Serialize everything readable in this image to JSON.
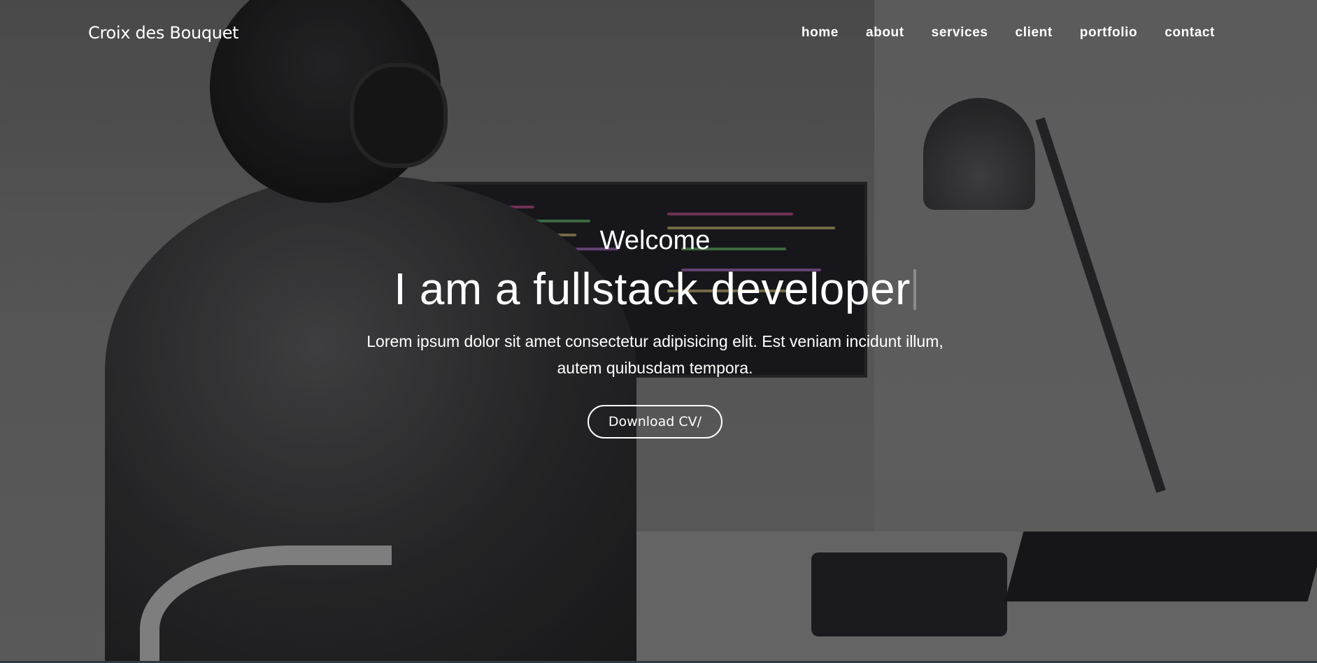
{
  "brand": {
    "name": "Croix des Bouquet"
  },
  "nav": {
    "items": [
      {
        "label": "home"
      },
      {
        "label": "about"
      },
      {
        "label": "services"
      },
      {
        "label": "client"
      },
      {
        "label": "portfolio"
      },
      {
        "label": "contact"
      }
    ]
  },
  "hero": {
    "welcome": "Welcome",
    "headline": "I am a fullstack developer",
    "description": "Lorem ipsum dolor sit amet consectetur adipisicing elit. Est veniam incidunt illum, autem quibusdam tempora.",
    "cta_label": "Download CV/"
  },
  "colors": {
    "text": "#ffffff",
    "footer_strip": "#2b3a44"
  },
  "icons": {
    "background_image": "developer-at-desk-photo"
  }
}
